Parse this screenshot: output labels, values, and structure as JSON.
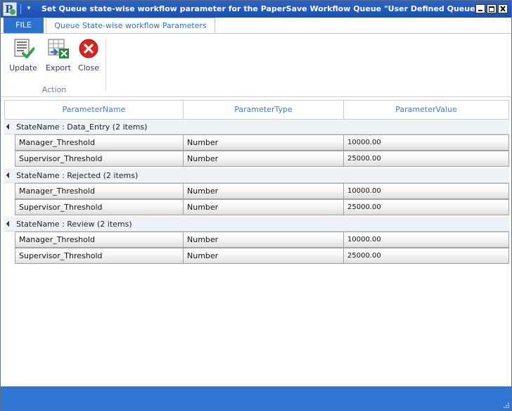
{
  "window": {
    "title": "Set Queue state-wise workflow parameter for the PaperSave Workflow Queue \"User Defined Queue\"",
    "app_icon_letter": "P",
    "quick_access_dropdown": "▾"
  },
  "ribbon": {
    "tabs": {
      "file": "FILE",
      "active": "Queue State-wise workflow Parameters"
    },
    "buttons": {
      "update": "Update",
      "export": "Export",
      "close": "Close"
    },
    "group_label": "Action"
  },
  "grid": {
    "columns": [
      "ParameterName",
      "ParameterType",
      "ParameterValue"
    ],
    "groups": [
      {
        "label": "StateName : Data_Entry (2 items)",
        "rows": [
          {
            "name": "Manager_Threshold",
            "type": "Number",
            "value": "10000.00"
          },
          {
            "name": "Supervisor_Threshold",
            "type": "Number",
            "value": "25000.00"
          }
        ]
      },
      {
        "label": "StateName : Rejected (2 items)",
        "rows": [
          {
            "name": "Manager_Threshold",
            "type": "Number",
            "value": "10000.00"
          },
          {
            "name": "Supervisor_Threshold",
            "type": "Number",
            "value": "25000.00"
          }
        ]
      },
      {
        "label": "StateName : Review (2 items)",
        "rows": [
          {
            "name": "Manager_Threshold",
            "type": "Number",
            "value": "10000.00"
          },
          {
            "name": "Supervisor_Threshold",
            "type": "Number",
            "value": "25000.00"
          }
        ]
      }
    ]
  },
  "colors": {
    "title_bar": "#1d4fae",
    "file_tab": "#2b73d1",
    "accent_text": "#3a7bd0",
    "status_bar": "#2f76d2",
    "check_green": "#3aa046",
    "close_red": "#d9251c"
  }
}
